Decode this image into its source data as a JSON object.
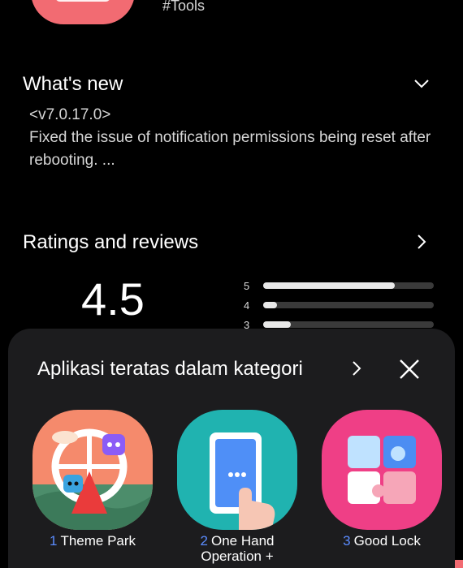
{
  "header": {
    "tag": "#Tools"
  },
  "whats_new": {
    "title": "What's new",
    "version": "<v7.0.17.0>",
    "text": "Fixed the issue of notification permissions being reset after rebooting. ..."
  },
  "ratings": {
    "title": "Ratings and reviews",
    "score": "4.5",
    "bars": [
      {
        "label": "5",
        "fraction": 0.77
      },
      {
        "label": "4",
        "fraction": 0.08
      },
      {
        "label": "3",
        "fraction": 0.16
      }
    ]
  },
  "sheet": {
    "title": "Aplikasi teratas dalam kategori",
    "apps": [
      {
        "rank": "1",
        "name": "Theme Park"
      },
      {
        "rank": "2",
        "name": "One Hand Operation +"
      },
      {
        "rank": "3",
        "name": "Good Lock"
      }
    ]
  },
  "colors": {
    "accent": "#5b8cff",
    "brand": "#f26b72",
    "sheet_bg": "#1c1c1e"
  }
}
